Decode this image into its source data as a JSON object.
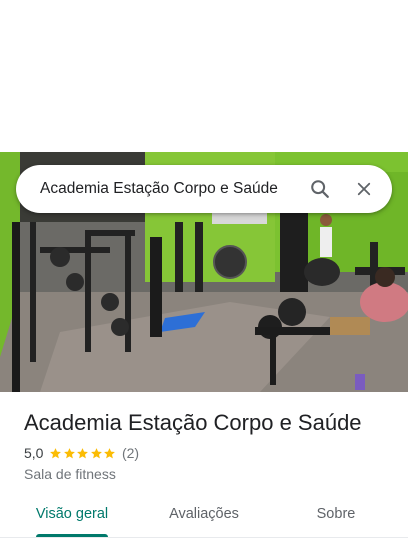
{
  "search": {
    "query": "Academia Estação Corpo e Saúde"
  },
  "place": {
    "name": "Academia Estação Corpo e Saúde",
    "rating": "5,0",
    "stars": 5,
    "review_count": "(2)",
    "category": "Sala de fitness"
  },
  "tabs": [
    {
      "label": "Visão geral",
      "active": true
    },
    {
      "label": "Avaliações",
      "active": false
    },
    {
      "label": "Sobre",
      "active": false
    }
  ],
  "colors": {
    "accent": "#00796b",
    "star": "#fbbc04",
    "wall_green": "#7fc72a"
  }
}
